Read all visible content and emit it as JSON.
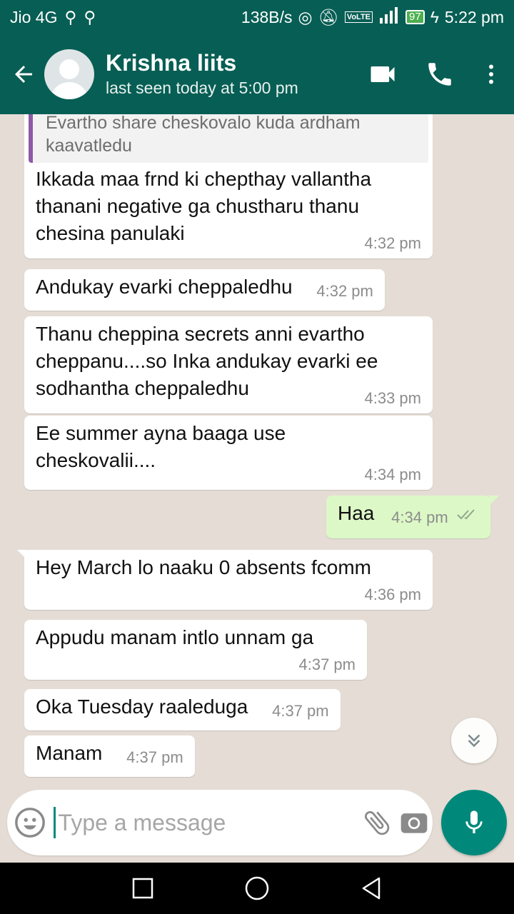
{
  "status_bar": {
    "carrier": "Jio 4G",
    "net_speed": "138B/s",
    "volte": "VoLTE",
    "battery": "97",
    "time": "5:22 pm"
  },
  "header": {
    "contact_name": "Krishna liits",
    "last_seen": "last seen today at 5:00 pm"
  },
  "messages": [
    {
      "dir": "in",
      "quote": "Evartho share cheskovalo kuda ardham kaavatledu",
      "text": "Ikkada maa frnd ki chepthay vallantha thanani negative ga chustharu thanu chesina panulaki",
      "time": "4:32 pm"
    },
    {
      "dir": "in",
      "text": "Andukay evarki cheppaledhu",
      "time": "4:32 pm"
    },
    {
      "dir": "in",
      "text": "Thanu cheppina secrets anni evartho cheppanu....so Inka andukay evarki ee sodhantha cheppaledhu",
      "time": "4:33 pm"
    },
    {
      "dir": "in",
      "text": "Ee summer ayna baaga use cheskovalii....",
      "time": "4:34 pm"
    },
    {
      "dir": "out",
      "text": "Haa",
      "time": "4:34 pm"
    },
    {
      "dir": "in",
      "text": "Hey March lo naaku 0 absents fcomm",
      "time": "4:36 pm"
    },
    {
      "dir": "in",
      "text": "Appudu manam intlo unnam ga",
      "time": "4:37 pm"
    },
    {
      "dir": "in",
      "text": "Oka Tuesday raaleduga",
      "time": "4:37 pm"
    },
    {
      "dir": "in",
      "text": "Manam",
      "time": "4:37 pm"
    }
  ],
  "composer": {
    "placeholder": "Type a message"
  },
  "colors": {
    "header": "#075e54",
    "accent": "#00897b",
    "outgoing_bubble": "#dcf8c6",
    "background": "#e5ddd5"
  }
}
